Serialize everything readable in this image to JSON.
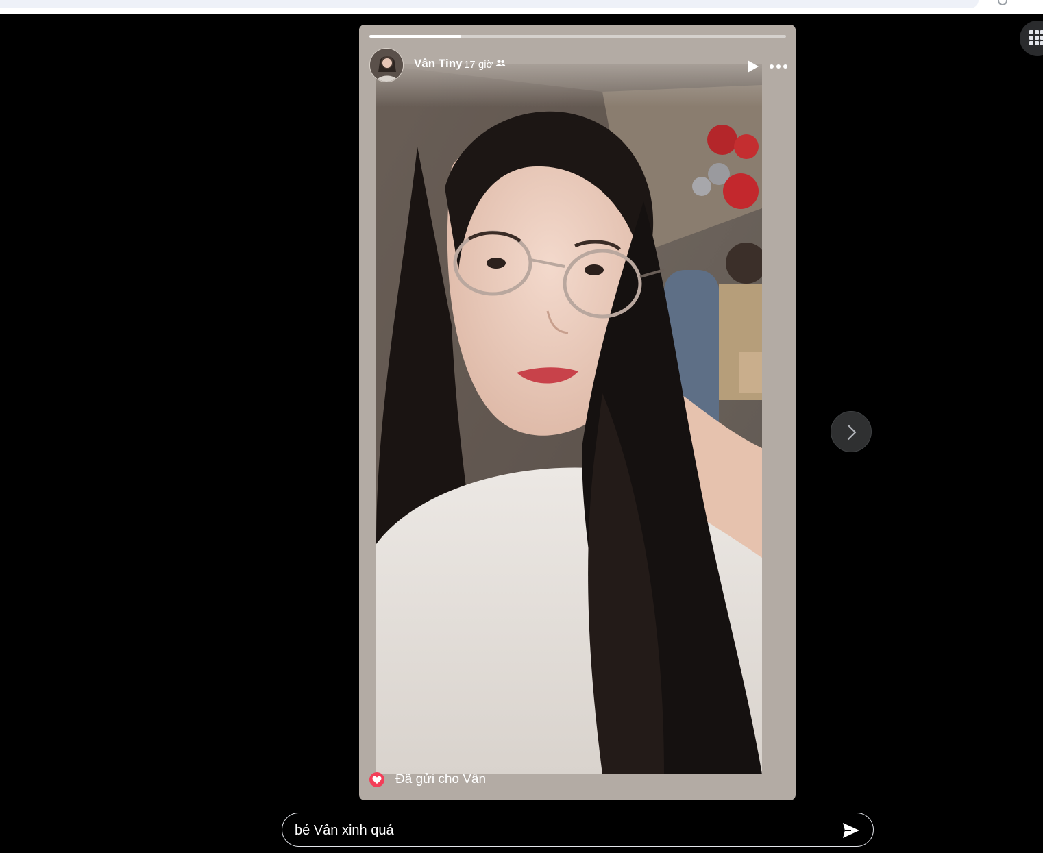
{
  "story": {
    "author": "Vân Tiny",
    "time": "17 giờ",
    "audience_icon": "friends-icon",
    "progress": 0.22,
    "reaction_status": "Đã gửi cho Vân",
    "reaction_icon": "heart-icon",
    "controls": {
      "play_icon": "play-icon",
      "more_icon": "more-options-icon"
    }
  },
  "reply": {
    "value": "bé Vân xinh quá",
    "send_icon": "send-icon"
  },
  "navigation": {
    "next_icon": "chevron-right-icon",
    "menu_icon": "app-grid-icon"
  },
  "colors": {
    "background": "#000000",
    "card": "#b3aba4",
    "reaction": "#f33e58"
  }
}
